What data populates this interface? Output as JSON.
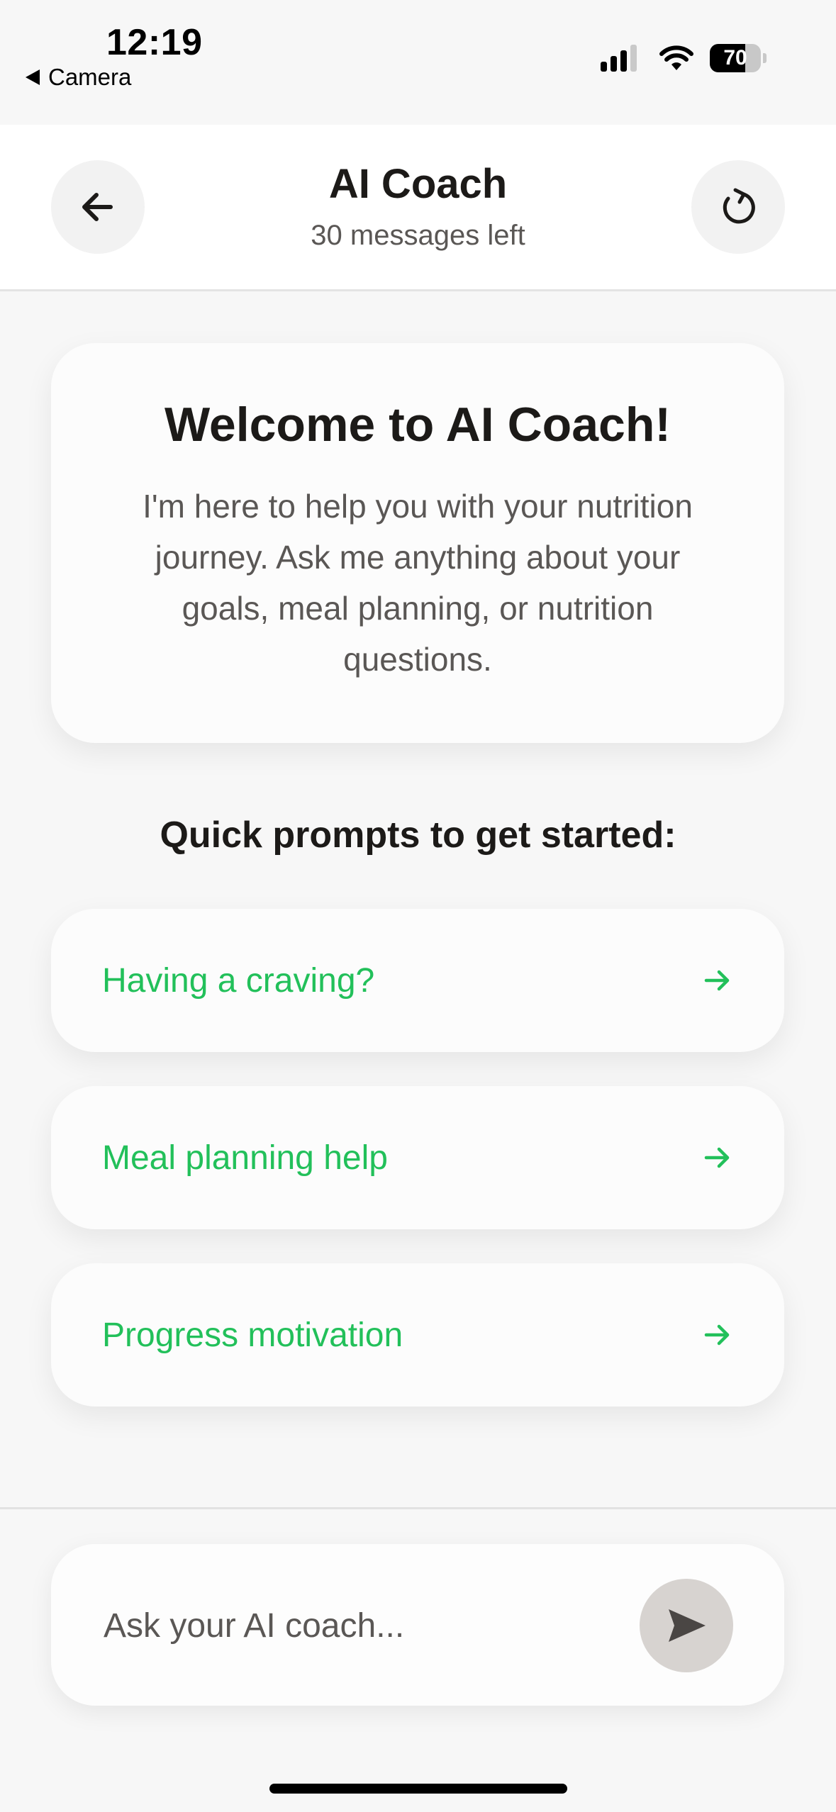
{
  "status_bar": {
    "time": "12:19",
    "back_app": "Camera",
    "battery_level": "70",
    "battery_fraction": 0.7,
    "signal_icon": "cellular-signal-icon",
    "wifi_icon": "wifi-icon"
  },
  "header": {
    "title": "AI Coach",
    "subtitle": "30 messages left",
    "back_icon": "arrow-left-icon",
    "refresh_icon": "refresh-icon"
  },
  "welcome": {
    "title": "Welcome to AI Coach!",
    "body": "I'm here to help you with your nutrition journey. Ask me anything about your goals, meal planning, or nutrition questions."
  },
  "prompts": {
    "heading": "Quick prompts to get started:",
    "items": [
      {
        "label": "Having a craving?"
      },
      {
        "label": "Meal planning help"
      },
      {
        "label": "Progress motivation"
      }
    ],
    "arrow_icon": "arrow-right-icon"
  },
  "composer": {
    "placeholder": "Ask your AI coach...",
    "value": "",
    "send_icon": "send-icon"
  },
  "colors": {
    "accent_green": "#22c05a",
    "background": "#f7f7f7",
    "card": "#fcfcfc",
    "send_button": "#d7d3d0"
  }
}
